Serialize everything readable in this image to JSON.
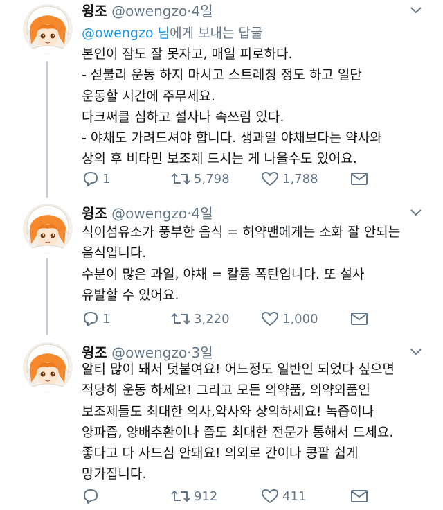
{
  "tweets": [
    {
      "name": "윙조",
      "handle": "@owengzo",
      "dot": "·",
      "time": "4일",
      "reply_to": {
        "link": "@owengzo 님",
        "rest": "에게 보내는 답글"
      },
      "lines": [
        "본인이 잠도 잘 못자고, 매일 피로하다.",
        "- 섣불리 운동 하지 마시고 스트레칭 정도 하고 일단",
        "운동할 시간에 주무세요.",
        "다크써클 심하고 설사나 속쓰림 있다.",
        "- 야채도 가려드셔야 합니다. 생과일 야채보다는 약사와",
        "상의 후 비타민 보조제 드시는 게 나을수도 있어요."
      ],
      "replies": "1",
      "retweets": "5,798",
      "likes": "1,788"
    },
    {
      "name": "윙조",
      "handle": "@owengzo",
      "dot": "·",
      "time": "4일",
      "lines": [
        "식이섬유소가 풍부한 음식 = 허약맨에게는 소화 잘 안되는",
        "음식입니다.",
        "수분이 많은 과일, 야채 = 칼륨 폭탄입니다. 또 설사",
        "유발할 수 있어요."
      ],
      "replies": "1",
      "retweets": "3,220",
      "likes": "1,000"
    },
    {
      "name": "윙조",
      "handle": "@owengzo",
      "dot": "·",
      "time": "3일",
      "lines": [
        "알티 많이 돼서 덧붙여요! 어느정도 일반인 되었다 싶으면",
        "적당히 운동 하세요! 그리고 모든 의약품, 의약외품인",
        "보조제들도 최대한 의사,약사와 상의하세요! 녹즙이나",
        "양파즙, 양배추환이나 즙도 최대한 전문가 통해서 드세요.",
        "좋다고 다 사드심 안돼요! 의외로 간이나 콩팥 쉽게",
        "망가집니다."
      ],
      "replies": "",
      "retweets": "912",
      "likes": "411"
    }
  ],
  "colors": {
    "accent": "#1b95e0",
    "muted": "#657786",
    "thread": "#c7cdd2",
    "text": "#14171a"
  },
  "icons": [
    "avatar-illustration",
    "chevron-down-icon",
    "reply-icon",
    "retweet-icon",
    "like-icon",
    "direct-message-icon"
  ]
}
